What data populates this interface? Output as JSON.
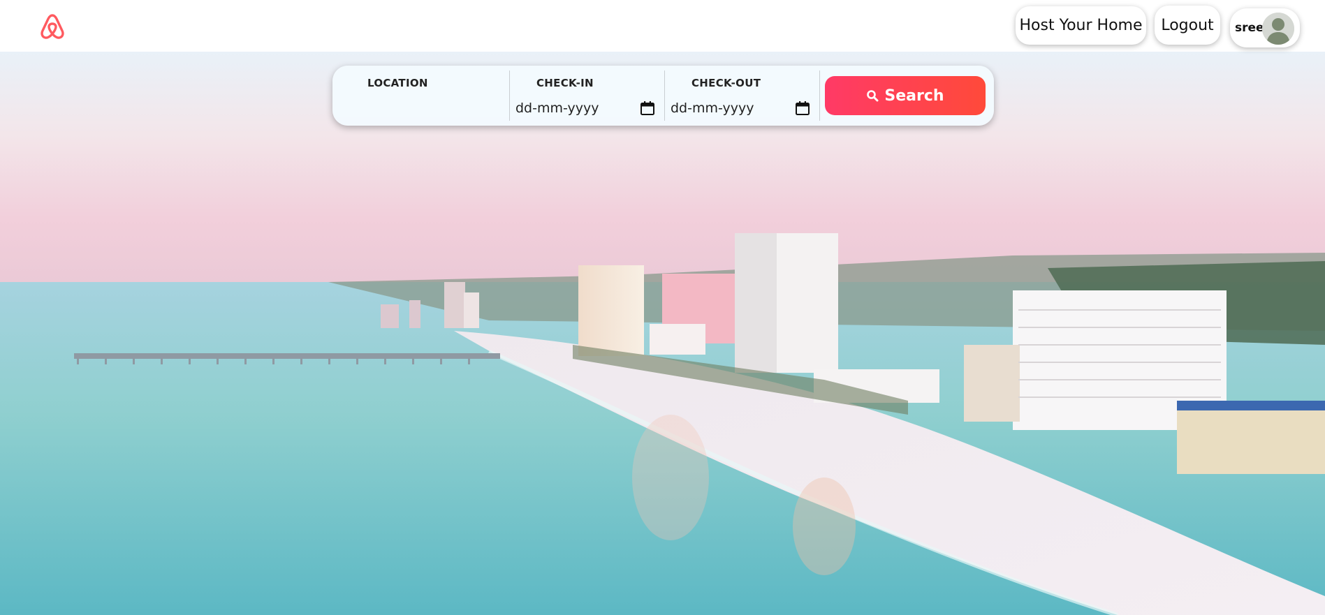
{
  "header": {
    "host_label": "Host Your Home",
    "logout_label": "Logout",
    "user_name": "sree",
    "brand_color": "#ff5a5f"
  },
  "search": {
    "location_label": "LOCATION",
    "location_value": "",
    "checkin_label": "CHECK-IN",
    "checkin_placeholder": "dd-mm-yyyy",
    "checkout_label": "CHECK-OUT",
    "checkout_placeholder": "dd-mm-yyyy",
    "button_label": "Search",
    "button_color": "#ff3d55"
  },
  "icons": {
    "logo": "airbnb-logo-icon",
    "calendar": "calendar-icon",
    "search": "magnifier-icon",
    "avatar": "user-avatar-icon"
  }
}
